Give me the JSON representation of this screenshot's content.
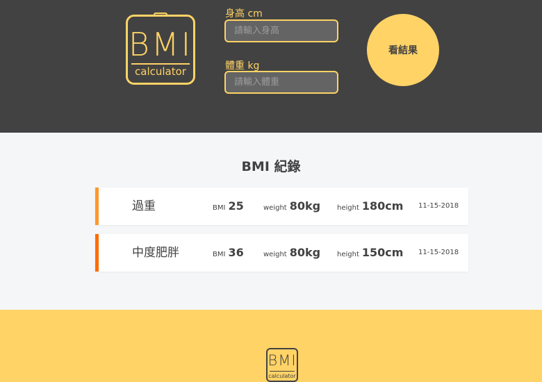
{
  "header": {
    "logo": {
      "main": "BMI",
      "sub": "calculator"
    },
    "height_label": "身高 cm",
    "height_placeholder": "請輸入身高",
    "weight_label": "體重 kg",
    "weight_placeholder": "請輸入體重",
    "result_button": "看結果"
  },
  "records": {
    "title": "BMI 紀錄",
    "items": [
      {
        "status": "過重",
        "bmi_key": "BMI",
        "bmi": "25",
        "weight_key": "weight",
        "weight": "80kg",
        "height_key": "height",
        "height": "180cm",
        "date": "11-15-2018",
        "color": "#ff982d"
      },
      {
        "status": "中度肥胖",
        "bmi_key": "BMI",
        "bmi": "36",
        "weight_key": "weight",
        "weight": "80kg",
        "height_key": "height",
        "height": "150cm",
        "date": "11-15-2018",
        "color": "#ff6c02"
      }
    ]
  },
  "footer": {
    "logo": {
      "main": "BMI",
      "sub": "calculator"
    }
  },
  "colors": {
    "accent": "#ffd366",
    "dark": "#424242",
    "overweight": "#ff982d",
    "obese": "#ff6c02"
  }
}
